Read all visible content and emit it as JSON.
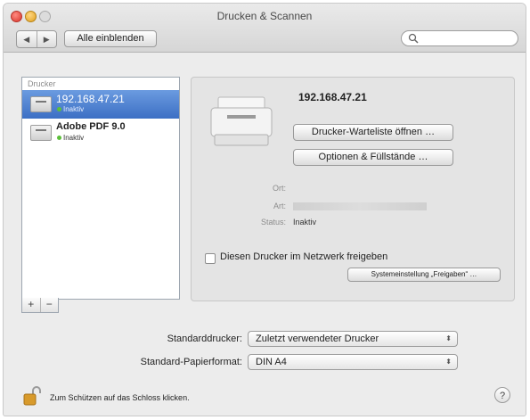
{
  "window": {
    "title": "Drucken & Scannen"
  },
  "toolbar": {
    "back_icon": "◀",
    "forward_icon": "▶",
    "show_all_label": "Alle einblenden",
    "search_placeholder": "",
    "search_value": ""
  },
  "sidebar": {
    "header": "Drucker",
    "printers": [
      {
        "name": "192.168.47.21",
        "status": "Inaktiv",
        "selected": true
      },
      {
        "name": "Adobe PDF 9.0",
        "status": "Inaktiv",
        "selected": false
      }
    ],
    "add_label": "+",
    "remove_label": "−"
  },
  "detail": {
    "printer_name": "192.168.47.21",
    "queue_button": "Drucker-Warteliste öffnen …",
    "options_button": "Optionen & Füllstände …",
    "info": {
      "location_label": "Ort:",
      "location_value": "",
      "type_label": "Art:",
      "status_label": "Status:",
      "status_value": "Inaktiv"
    },
    "share_label": "Diesen Drucker im Netzwerk freigeben",
    "share_checked": false,
    "system_prefs_button": "Systemeinstellung „Freigaben“ …"
  },
  "defaults": {
    "default_printer_label": "Standarddrucker:",
    "default_printer_value": "Zuletzt verwendeter Drucker",
    "paper_size_label": "Standard-Papierformat:",
    "paper_size_value": "DIN A4"
  },
  "footer": {
    "lock_text": "Zum Schützen auf das Schloss klicken.",
    "help_label": "?"
  },
  "colors": {
    "selection": "#3c6fc4",
    "status_dot": "#5cbf3a",
    "window_bg": "#ececec"
  }
}
